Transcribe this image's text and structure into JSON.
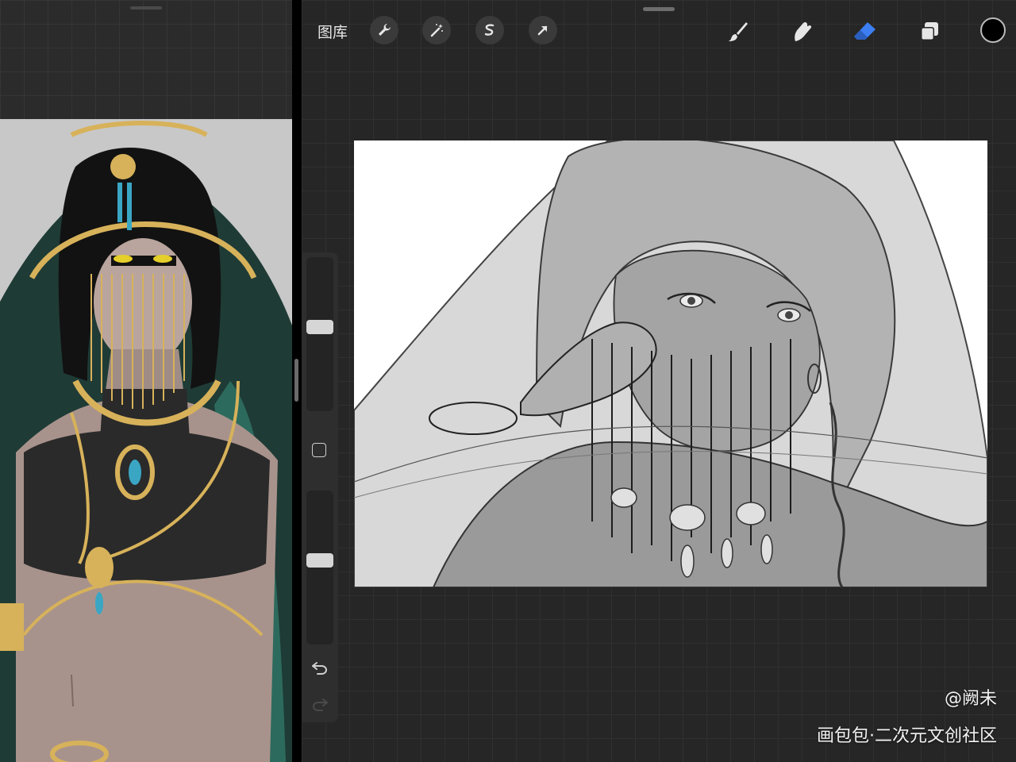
{
  "toolbar": {
    "gallery_label": "图库",
    "left_tools": [
      "wrench-icon",
      "magic-wand-icon",
      "selection-icon",
      "transform-arrow-icon"
    ],
    "right_tools": [
      "brush-icon",
      "smudge-icon",
      "eraser-icon",
      "layers-icon"
    ],
    "active_tool": "eraser-icon",
    "current_color": "#000000",
    "accent_color": "#3d7ff2"
  },
  "sidebar": {
    "brush_size_level": 0.55,
    "opacity_level": 0.55,
    "icons": [
      "modify-square-icon",
      "undo-icon",
      "redo-icon"
    ]
  },
  "watermark": {
    "author": "@阙未",
    "site": "画包包·二次元文创社区"
  }
}
